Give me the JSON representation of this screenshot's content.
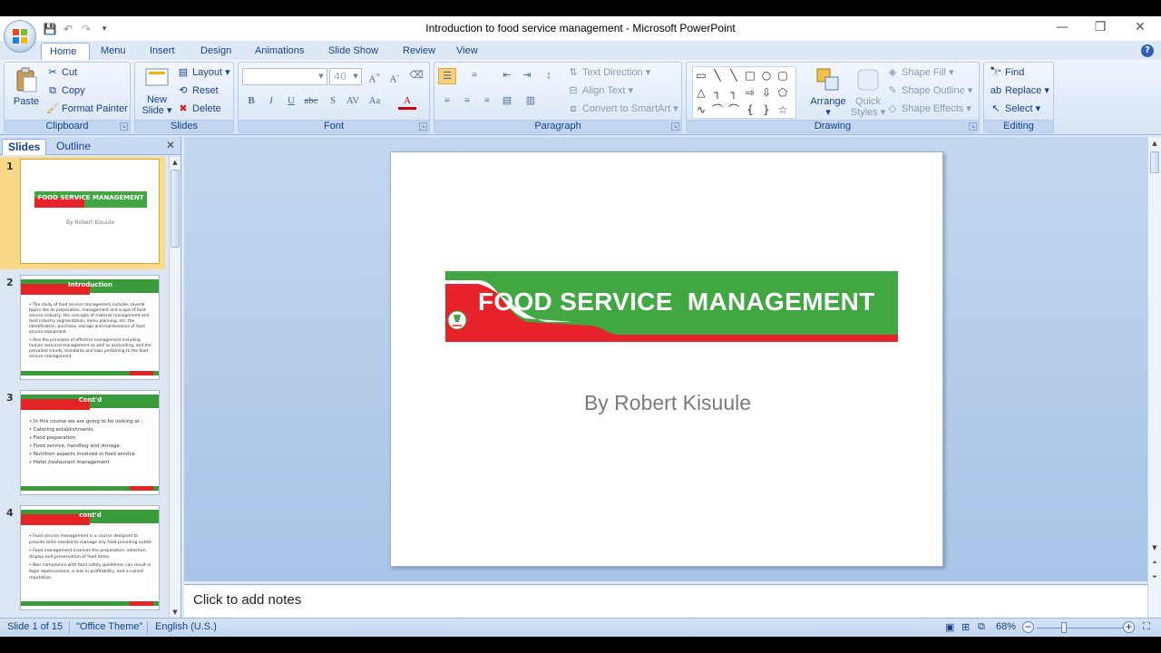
{
  "window": {
    "title": "Introduction to food service management - Microsoft PowerPoint",
    "qat_icons": [
      "save-icon",
      "undo-icon",
      "redo-icon",
      "customize-icon"
    ]
  },
  "tabs": [
    "Home",
    "Menu",
    "Insert",
    "Design",
    "Animations",
    "Slide Show",
    "Review",
    "View"
  ],
  "active_tab": "Home",
  "ribbon": {
    "clipboard": {
      "label": "Clipboard",
      "paste": "Paste",
      "cut": "Cut",
      "copy": "Copy",
      "format_painter": "Format Painter"
    },
    "slides": {
      "label": "Slides",
      "new_slide_line1": "New",
      "new_slide_line2": "Slide",
      "layout": "Layout",
      "reset": "Reset",
      "delete": "Delete"
    },
    "font": {
      "label": "Font",
      "font_name": "",
      "font_size": "40"
    },
    "paragraph": {
      "label": "Paragraph",
      "text_direction": "Text Direction",
      "align_text": "Align Text",
      "convert_smartart": "Convert to SmartArt"
    },
    "drawing": {
      "label": "Drawing",
      "arrange": "Arrange",
      "quick_styles_line1": "Quick",
      "quick_styles_line2": "Styles",
      "shape_fill": "Shape Fill",
      "shape_outline": "Shape Outline",
      "shape_effects": "Shape Effects"
    },
    "editing": {
      "label": "Editing",
      "find": "Find",
      "replace": "Replace",
      "select": "Select"
    }
  },
  "slides_pane": {
    "tabs": [
      "Slides",
      "Outline"
    ],
    "thumbnails": [
      {
        "num": "1",
        "title": "FOOD SERVICE  MANAGEMENT",
        "subtitle": "By Robert Kisuule",
        "lines": []
      },
      {
        "num": "2",
        "title": "Introduction",
        "lines": [
          "• The study of food service management includes several topics like its preparation, management and scope of food service industry, the concepts of material management and food industry segmentation, menu planning, etc. the identification, purchase, storage and maintenance of food service equipment.",
          "• Also the principles of effective management including human resource management as well as accounting, and the prevalent trends, standards and laws pertaining to the food service management."
        ]
      },
      {
        "num": "3",
        "title": "Cont'd",
        "lines": [
          "• In this course we are going to be looking at ;",
          "• Catering establishments",
          "• Food preparation",
          "• Food service, handling and storage.",
          "• Nutrition aspects involved in food service",
          "• Hotel /restaurant management"
        ]
      },
      {
        "num": "4",
        "title": "cont'd",
        "lines": [
          "• Food service management is a course designed to provide skills needed to manage any food providing outlet.",
          "• Food management involves the preparation, selection, display and preservation of food items.",
          "• Non compliance with food safety guidelines can result in legal repercussions, a loss in profitability, and a ruined reputation."
        ]
      }
    ]
  },
  "slide": {
    "title": "FOOD SERVICE  MANAGEMENT",
    "subtitle": "By Robert Kisuule",
    "colors": {
      "green": "#41a841",
      "red": "#e8222b"
    }
  },
  "notes_placeholder": "Click to add notes",
  "status": {
    "slide_info": "Slide 1 of 15",
    "theme": "\"Office Theme\"",
    "language": "English (U.S.)",
    "zoom": "68%"
  }
}
